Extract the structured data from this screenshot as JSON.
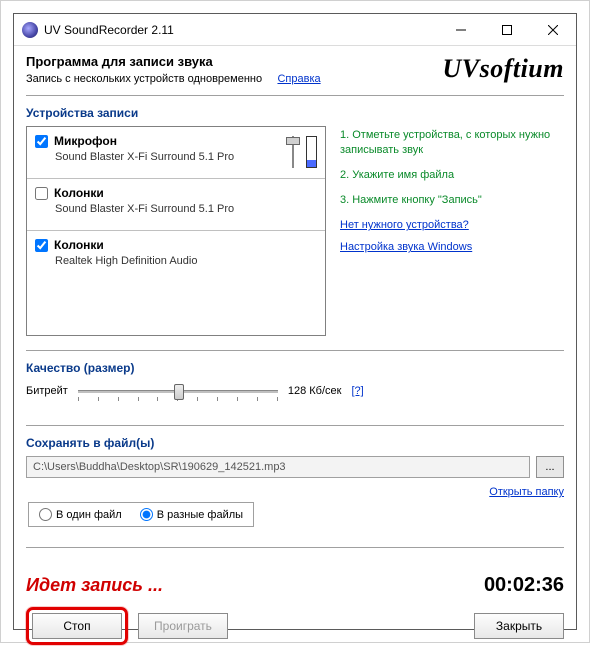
{
  "window": {
    "title": "UV SoundRecorder 2.11"
  },
  "header": {
    "title": "Программа для записи звука",
    "subtitle": "Запись с нескольких устройств одновременно",
    "help": "Справка",
    "logo": "UVsoftium"
  },
  "sections": {
    "devices_title": "Устройства записи",
    "quality_title": "Качество (размер)",
    "save_title": "Сохранять в файл(ы)"
  },
  "devices": [
    {
      "checked": true,
      "name": "Микрофон",
      "desc": "Sound Blaster X-Fi Surround 5.1 Pro",
      "slider_pos": 0.05,
      "level": 0.2
    },
    {
      "checked": false,
      "name": "Колонки",
      "desc": "Sound Blaster X-Fi Surround 5.1 Pro",
      "slider_pos": 0.5,
      "level": 0.0
    },
    {
      "checked": true,
      "name": "Колонки",
      "desc": "Realtek High Definition Audio",
      "slider_pos": 0.5,
      "level": 0.0
    }
  ],
  "instructions": {
    "steps": [
      "1. Отметьте устройства, с которых нужно записывать звук",
      "2. Укажите имя файла",
      "3. Нажмите кнопку \"Запись\""
    ],
    "links": [
      "Нет нужного устройства?",
      "Настройка звука Windows"
    ]
  },
  "bitrate": {
    "label": "Битрейт",
    "value_text": "128 Кб/сек",
    "help": "[?]",
    "pos": 0.5
  },
  "save": {
    "path": "C:\\Users\\Buddha\\Desktop\\SR\\190629_142521.mp3",
    "browse": "...",
    "open_folder": "Открыть папку",
    "radio_one": "В один файл",
    "radio_many": "В разные файлы",
    "selected": "many"
  },
  "status": {
    "text": "Идет запись ...",
    "timer": "00:02:36"
  },
  "buttons": {
    "stop": "Стоп",
    "play": "Проиграть",
    "close": "Закрыть"
  }
}
